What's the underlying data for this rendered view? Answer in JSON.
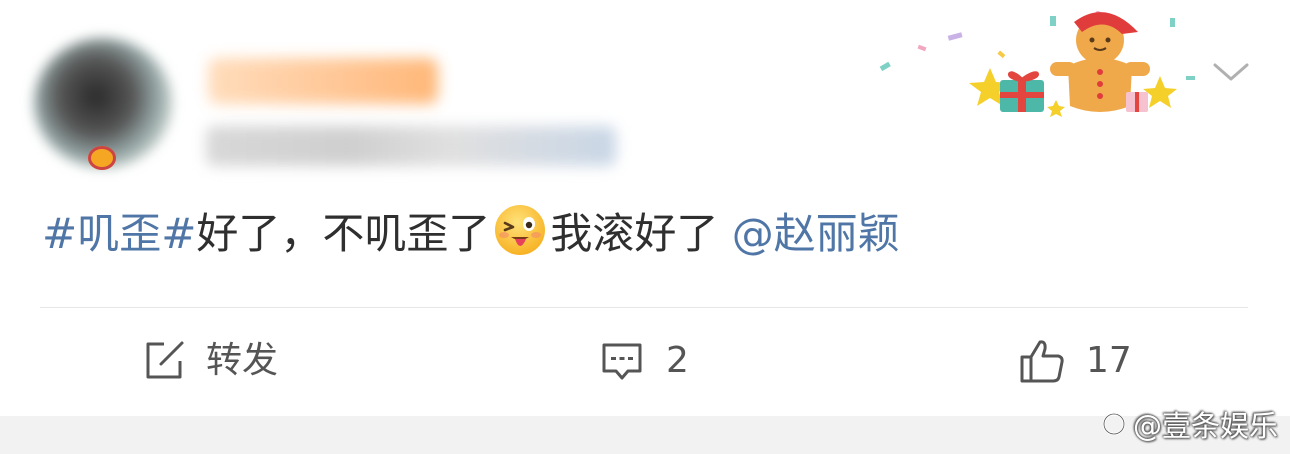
{
  "post": {
    "topic": "#叽歪#",
    "text_before_emoji": "好了，不叽歪了",
    "emoji": "tongue-wink-emoji",
    "text_after_emoji": "我滚好了",
    "mention": "@赵丽颖"
  },
  "actions": {
    "repost_label": "转发",
    "comment_count": "2",
    "like_count": "17"
  },
  "watermark": {
    "text": "@壹条娱乐"
  },
  "colors": {
    "link": "#4f76a6",
    "text": "#2f2f2f",
    "icon": "#555555"
  }
}
